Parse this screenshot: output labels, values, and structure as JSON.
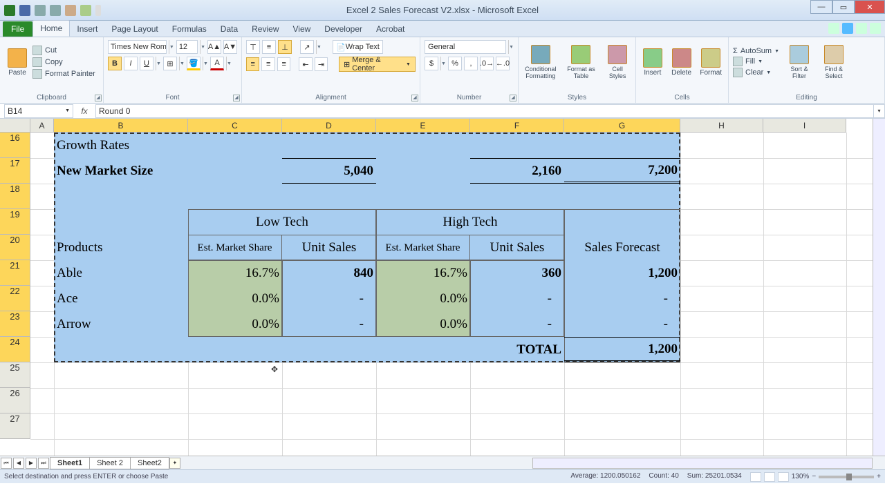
{
  "title": "Excel 2 Sales Forecast V2.xlsx - Microsoft Excel",
  "tabs": {
    "file": "File",
    "home": "Home",
    "insert": "Insert",
    "pagelayout": "Page Layout",
    "formulas": "Formulas",
    "data": "Data",
    "review": "Review",
    "view": "View",
    "developer": "Developer",
    "acrobat": "Acrobat"
  },
  "ribbon": {
    "clipboard": {
      "paste": "Paste",
      "cut": "Cut",
      "copy": "Copy",
      "fp": "Format Painter",
      "label": "Clipboard"
    },
    "font": {
      "name": "Times New Roma",
      "size": "12",
      "label": "Font"
    },
    "alignment": {
      "wrap": "Wrap Text",
      "merge": "Merge & Center",
      "label": "Alignment"
    },
    "number": {
      "format": "General",
      "label": "Number"
    },
    "styles": {
      "cf": "Conditional Formatting",
      "fat": "Format as Table",
      "cs": "Cell Styles",
      "label": "Styles"
    },
    "cells": {
      "insert": "Insert",
      "delete": "Delete",
      "format": "Format",
      "label": "Cells"
    },
    "editing": {
      "autosum": "AutoSum",
      "fill": "Fill",
      "clear": "Clear",
      "sort": "Sort & Filter",
      "find": "Find & Select",
      "label": "Editing"
    }
  },
  "namebox": "B14",
  "formula": "Round 0",
  "columns": [
    "A",
    "B",
    "C",
    "D",
    "E",
    "F",
    "G",
    "H",
    "I"
  ],
  "rows": [
    "16",
    "17",
    "18",
    "19",
    "20",
    "21",
    "22",
    "23",
    "24",
    "25",
    "26",
    "27"
  ],
  "cells": {
    "b16": "Growth Rates",
    "b17": "New Market Size",
    "d17": "5,040",
    "f17": "2,160",
    "g17": "7,200",
    "cd19": "Low Tech",
    "ef19": "High   Tech",
    "b20": "Products",
    "c20": "Est. Market Share",
    "d20": "Unit Sales",
    "e20": "Est. Market Share",
    "f20": "Unit Sales",
    "g20": "Sales Forecast",
    "b21": "Able",
    "c21": "16.7%",
    "d21": "840",
    "e21": "16.7%",
    "f21": "360",
    "g21": "1,200",
    "b22": "Ace",
    "c22": "0.0%",
    "d22": "-",
    "e22": "0.0%",
    "f22": "-",
    "g22": "-",
    "b23": "Arrow",
    "c23": "0.0%",
    "d23": "-",
    "e23": "0.0%",
    "f23": "-",
    "g23": "-",
    "f24": "TOTAL",
    "g24": "1,200"
  },
  "sheets": {
    "s1": "Sheet1",
    "s2": "Sheet 2",
    "s3": "Sheet2"
  },
  "status": {
    "msg": "Select destination and press ENTER or choose Paste",
    "avg": "Average: 1200.050162",
    "count": "Count: 40",
    "sum": "Sum: 25201.0534",
    "zoom": "130%"
  }
}
